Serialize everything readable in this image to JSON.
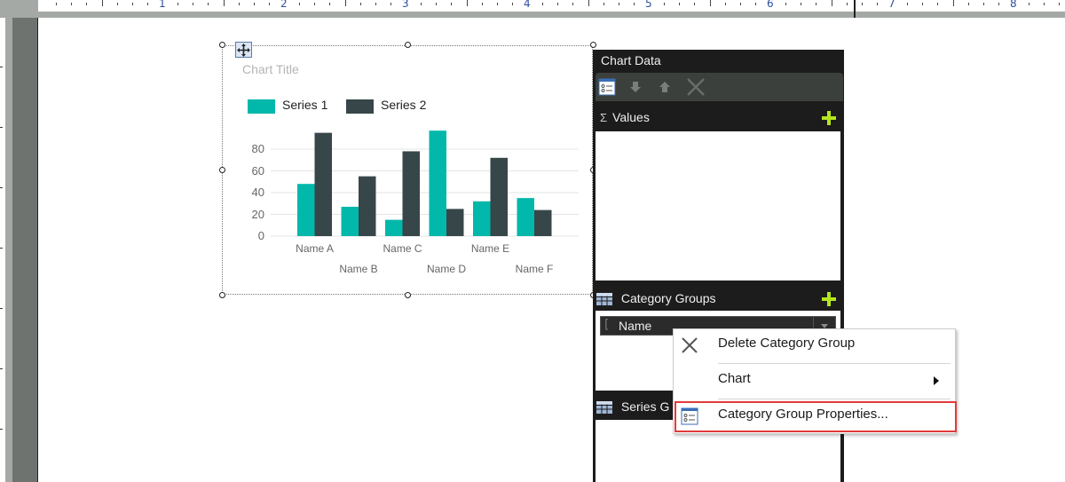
{
  "ruler": {
    "numbers": [
      "1",
      "2",
      "3",
      "4",
      "5",
      "6",
      "7",
      "8"
    ]
  },
  "chart": {
    "title": "Chart Title",
    "legend": [
      {
        "label": "Series 1",
        "color": "#01b8aa"
      },
      {
        "label": "Series 2",
        "color": "#374649"
      }
    ]
  },
  "chart_data": {
    "type": "bar",
    "title": "Chart Title",
    "xlabel": "",
    "ylabel": "",
    "categories": [
      "Name A",
      "Name B",
      "Name C",
      "Name D",
      "Name E",
      "Name F"
    ],
    "series": [
      {
        "name": "Series 1",
        "color": "#01b8aa",
        "values": [
          48,
          27,
          15,
          97,
          32,
          35
        ]
      },
      {
        "name": "Series 2",
        "color": "#374649",
        "values": [
          95,
          55,
          78,
          25,
          72,
          24
        ]
      }
    ],
    "yticks": [
      "0",
      "20",
      "40",
      "60",
      "80"
    ],
    "ylim": [
      0,
      100
    ],
    "grid": true,
    "legend_position": "top-left"
  },
  "chart_data_panel": {
    "title": "Chart Data",
    "toolbar": {
      "properties_icon": "properties-icon",
      "move_down_icon": "arrow-down-icon",
      "move_up_icon": "arrow-up-icon",
      "delete_icon": "delete-icon"
    },
    "values_label": "Values",
    "category_groups_label": "Category Groups",
    "category_field": "Name",
    "series_groups_label": "Series G"
  },
  "context_menu": {
    "items": [
      {
        "label": "Delete Category Group",
        "icon": "delete-x-icon"
      },
      {
        "label": "Chart",
        "submenu": true
      },
      {
        "label": "Category Group Properties...",
        "icon": "properties-icon",
        "highlighted": true
      }
    ]
  }
}
